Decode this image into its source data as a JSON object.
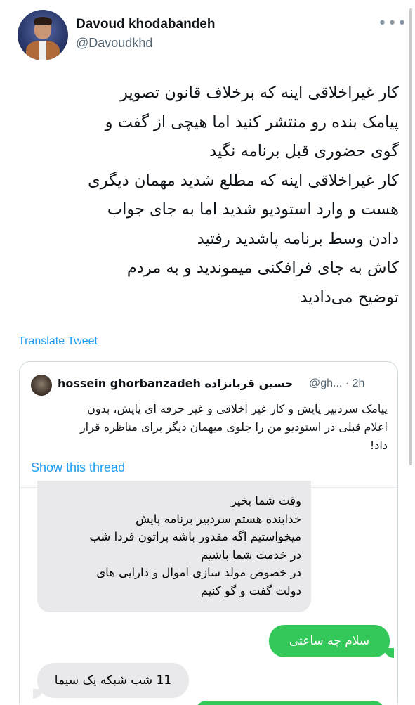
{
  "tweet": {
    "author_name": "Davoud khodabandeh",
    "author_handle": "@Davoudkhd",
    "more_icon": "more-horizontal-icon",
    "text_lines": [
      "کار غیراخلاقی اینه که برخلاف قانون تصویر",
      "پیامک بنده رو منتشر کنید اما هیچی از  گفت و",
      "گوی حضوری قبل برنامه نگید",
      "کار غیراخلاقی اینه که مطلع شدید مهمان دیگری",
      "هست و وارد استودیو شدید اما به جای جواب",
      "دادن وسط برنامه پاشدید رفتید",
      "کاش به جای فرافکنی میموندید و به مردم",
      "توضیح می‌دادید"
    ],
    "translate_label": "Translate Tweet"
  },
  "quote": {
    "author_name": "hossein ghorbanzadeh حسین قربانزاده",
    "meta": "@gh... · 2h",
    "text_lines": [
      "پیامک سردبیر پایش و کار غیر اخلاقی و غیر حرفه ای پایش، بدون",
      "اعلام قبلی در استودیو من را جلوی میهمان دیگر برای مناظره قرار",
      "داد!"
    ],
    "show_thread_label": "Show this thread",
    "messages": {
      "incoming_long": [
        "وقت شما بخیر",
        "خدابنده هستم سردبیر برنامه پایش",
        "میخواستیم اگه مقدور باشه براتون فردا شب",
        "در خدمت شما باشیم",
        "در خصوص مولد سازی اموال و دارایی های",
        "دولت گفت و گو کنیم"
      ],
      "outgoing": "سلام چه ساعتی",
      "incoming_short": "11 شب شبکه یک سیما"
    },
    "colors": {
      "incoming_bubble": "#e9e9eb",
      "outgoing_bubble": "#34c759",
      "link": "#1d9bf0"
    }
  }
}
